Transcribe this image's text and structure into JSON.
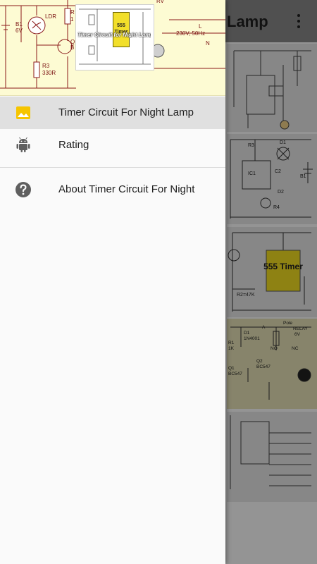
{
  "app_bar": {
    "title_fragment": "Lamp",
    "overflow_icon": "more-vert-icon"
  },
  "drawer_header": {
    "thumbnail_title": "Timer Circuit for Night Lamp",
    "thumbnail_chip": "555 Timer",
    "labels": {
      "b1": "B1",
      "b1_voltage": "6V",
      "ldr": "LDR",
      "r_top": "R",
      "r_top_value": "1",
      "q": "Q",
      "b": "B",
      "r3": "R3",
      "r3_value": "330R",
      "mains": "230V, 50Hz",
      "l": "L",
      "n": "N",
      "rv": "RV"
    }
  },
  "menu": {
    "items": [
      {
        "label": "Timer Circuit For Night Lamp",
        "icon": "image-icon",
        "active": true
      },
      {
        "label": "Rating",
        "icon": "android-icon",
        "active": false
      }
    ],
    "secondary": [
      {
        "label": "About Timer Circuit For Night",
        "icon": "help-icon"
      }
    ]
  },
  "background_content": {
    "card3_chip": "555 Timer",
    "card3_label": "R2=47K",
    "card4_labels": [
      "D1",
      "1N4001",
      "Pole",
      "RELAY",
      "6V",
      "NO",
      "NC",
      "R1",
      "1K",
      "Q1",
      "BC547",
      "Q2",
      "BC547",
      "A"
    ],
    "card2_labels": [
      "R3",
      "D1",
      "IC1",
      "C2",
      "B1",
      "D2",
      "R4"
    ]
  },
  "colors": {
    "accent_yellow": "#f6c500",
    "drawer_bg": "#fafafa",
    "active_item_bg": "#e0e0e0",
    "header_bg": "#fdfbd3"
  }
}
